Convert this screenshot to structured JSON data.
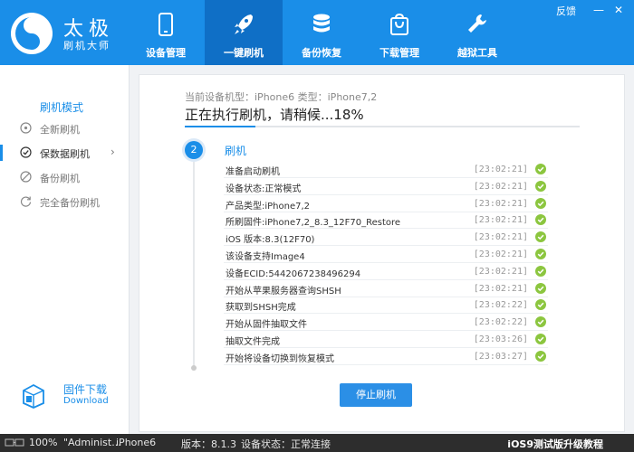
{
  "app": {
    "logo_title": "太极",
    "logo_subtitle": "刷机大师",
    "feedback": "反馈",
    "minimize": "—",
    "close": "✕"
  },
  "nav": [
    {
      "label": "设备管理",
      "icon": "phone-icon",
      "active": false
    },
    {
      "label": "一键刷机",
      "icon": "rocket-icon",
      "active": true
    },
    {
      "label": "备份恢复",
      "icon": "database-icon",
      "active": false
    },
    {
      "label": "下载管理",
      "icon": "shopping-bag-icon",
      "active": false
    },
    {
      "label": "越狱工具",
      "icon": "wrench-icon",
      "active": false
    }
  ],
  "sidebar": {
    "title": "刷机模式",
    "items": [
      {
        "label": "全新刷机",
        "icon": "plus-circle-icon",
        "active": false
      },
      {
        "label": "保数据刷机",
        "icon": "check-circle-icon",
        "active": true,
        "chevron": "›"
      },
      {
        "label": "备份刷机",
        "icon": "no-entry-icon",
        "active": false
      },
      {
        "label": "完全备份刷机",
        "icon": "refresh-icon",
        "active": false
      }
    ],
    "firmware": {
      "label_cn": "固件下载",
      "label_en": "Download"
    }
  },
  "main": {
    "device_line": "当前设备机型：iPhone6 类型：iPhone7,2",
    "status_line": "正在执行刷机，请稍候...18%",
    "progress": 0.18,
    "step_number": "2",
    "step_title": "刷机",
    "log": [
      {
        "text": "准备启动刷机",
        "time": "[23:02:21]"
      },
      {
        "text": "设备状态:正常模式",
        "time": "[23:02:21]"
      },
      {
        "text": "产品类型:iPhone7,2",
        "time": "[23:02:21]"
      },
      {
        "text": "所刷固件:iPhone7,2_8.3_12F70_Restore",
        "time": "[23:02:21]"
      },
      {
        "text": "iOS 版本:8.3(12F70)",
        "time": "[23:02:21]"
      },
      {
        "text": "该设备支持Image4",
        "time": "[23:02:21]"
      },
      {
        "text": "设备ECID:5442067238496294",
        "time": "[23:02:21]"
      },
      {
        "text": "开始从苹果服务器查询SHSH",
        "time": "[23:02:21]"
      },
      {
        "text": "获取到SHSH完成",
        "time": "[23:02:22]"
      },
      {
        "text": "开始从固件抽取文件",
        "time": "[23:02:22]"
      },
      {
        "text": "抽取文件完成",
        "time": "[23:03:26]"
      },
      {
        "text": "开始将设备切换到恢复模式",
        "time": "[23:03:27]"
      }
    ],
    "stop_button": "停止刷机"
  },
  "statusbar": {
    "zoom": "100%",
    "user": "\"Administ...",
    "device": "iPhone6",
    "version": "版本：8.1.3",
    "device_status": "设备状态：正常连接",
    "promo": "iOS9测试版升级教程"
  },
  "colors": {
    "primary": "#1a8ee8",
    "nav_active": "#0f6fc6",
    "success": "#8cc63f",
    "statusbar": "#2d2d2d"
  }
}
